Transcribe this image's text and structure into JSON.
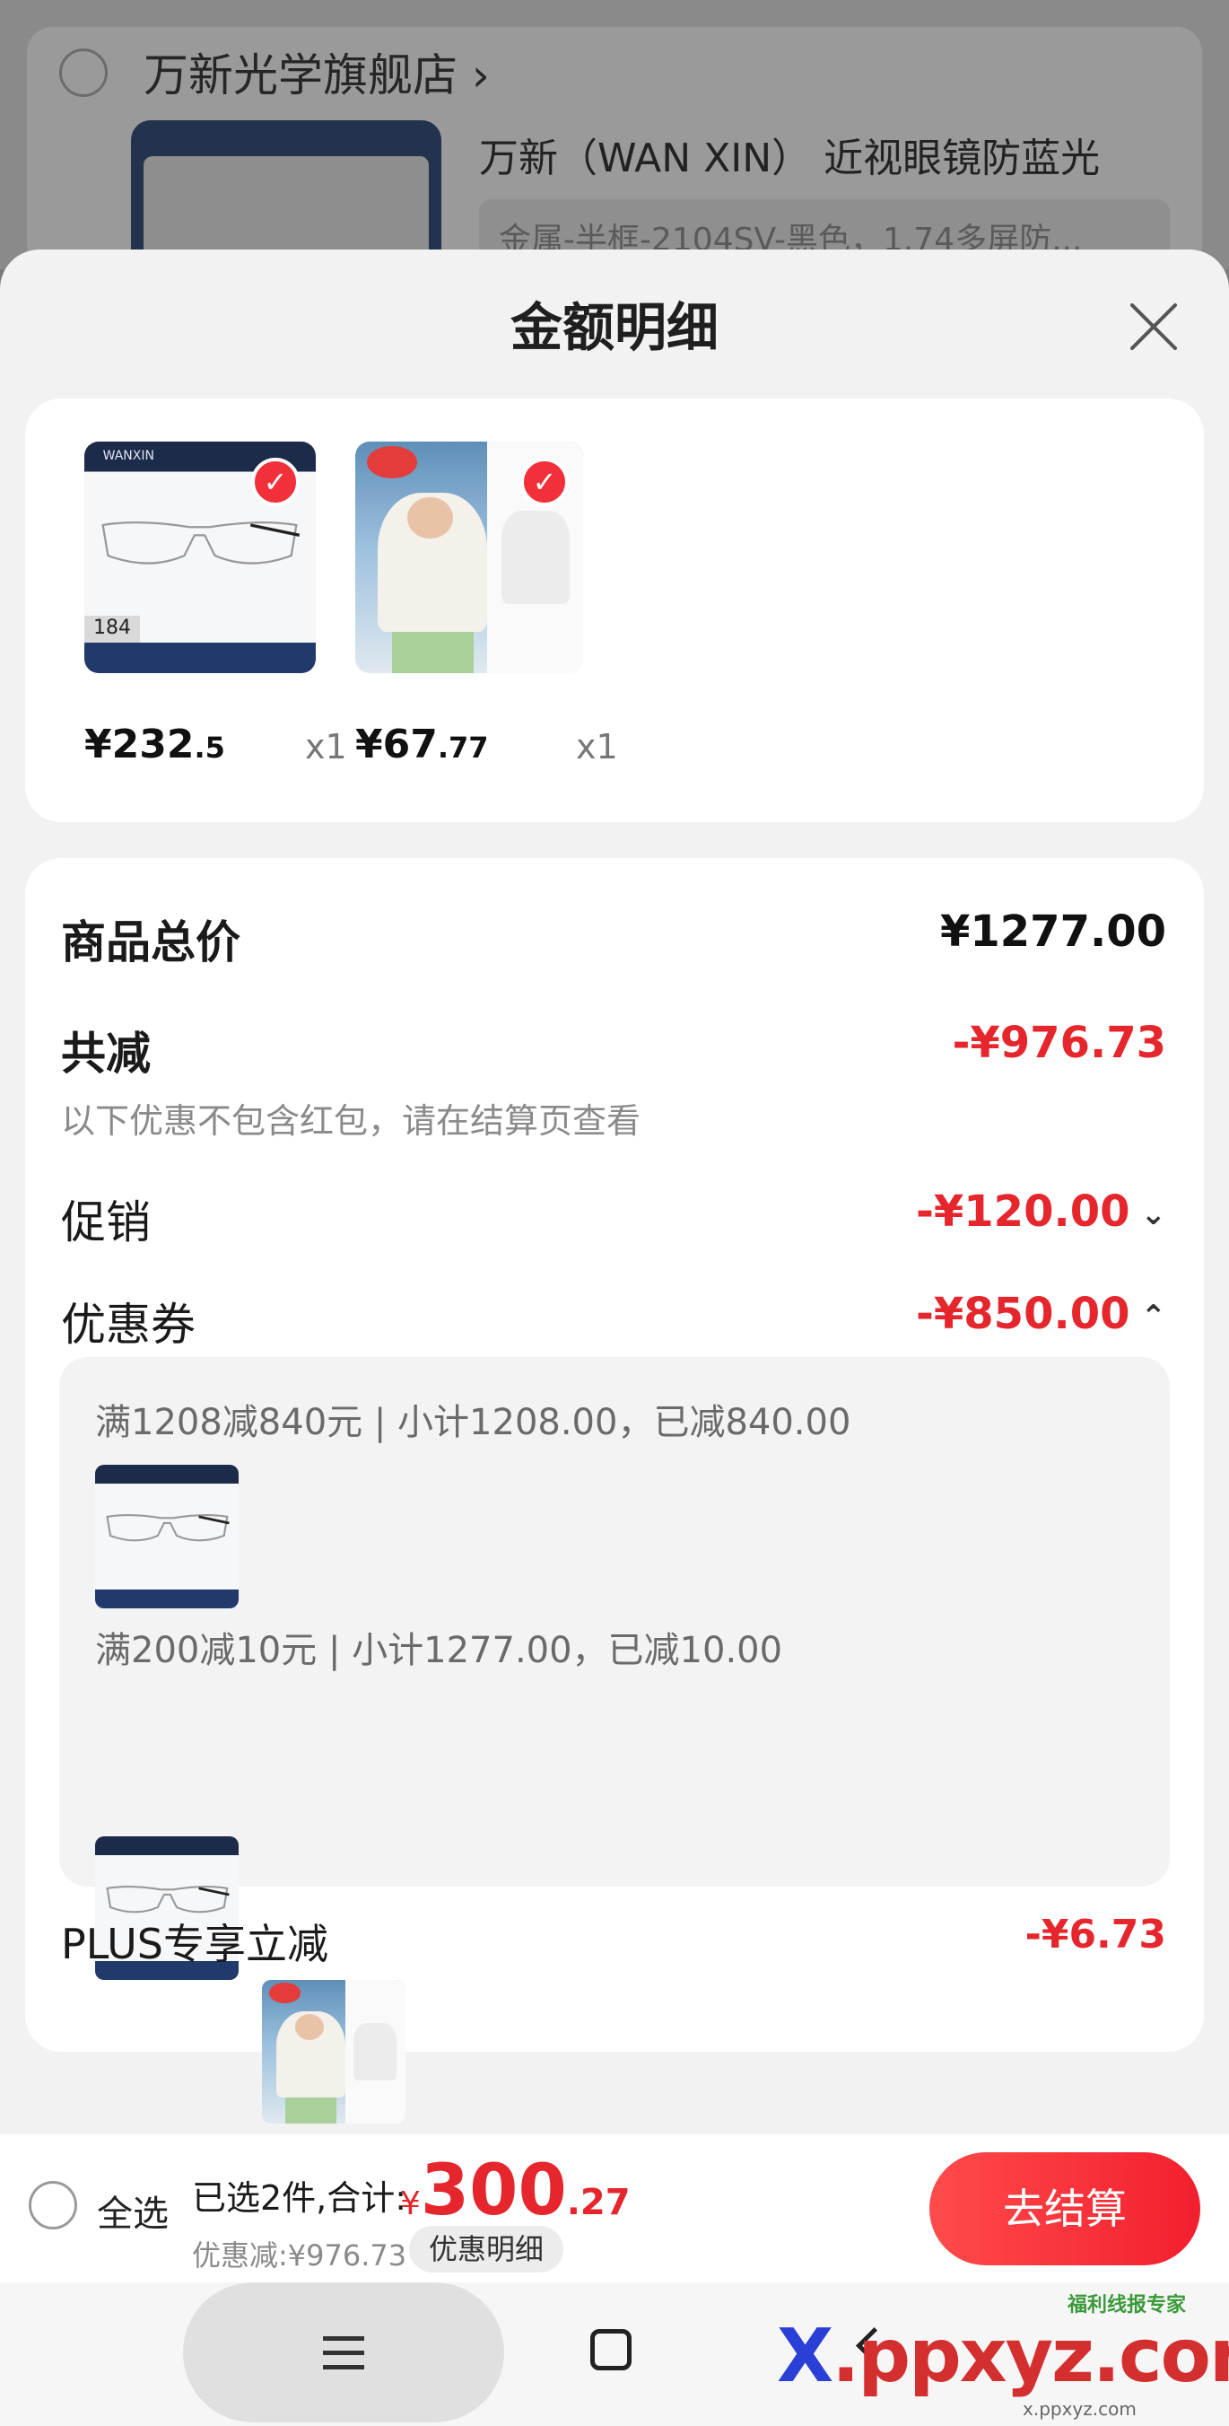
{
  "background": {
    "store_name": "万新光学旗舰店 ›",
    "product_title": "万新（WAN XIN） 近视眼镜防蓝光",
    "product_spec": "金属-半框-2104SV-黑色，1.74多屏防..."
  },
  "sheet": {
    "title": "金额明细"
  },
  "products": [
    {
      "price_int": "¥232",
      "price_dec": ".5",
      "qty": "x1",
      "thumb_price": "184"
    },
    {
      "price_int": "¥67",
      "price_dec": ".77",
      "qty": "x1"
    }
  ],
  "summary": {
    "total_label": "商品总价",
    "total_value": "¥1277.00",
    "discount_label": "共减",
    "discount_value": "-¥976.73",
    "discount_note": "以下优惠不包含红包，请在结算页查看",
    "promo_label": "促销",
    "promo_value": "-¥120.00",
    "coupon_label": "优惠券",
    "coupon_value": "-¥850.00",
    "coupons": [
      {
        "text": "满1208减840元 | 小计1208.00，已减840.00"
      },
      {
        "text": "满200减10元 | 小计1277.00，已减10.00"
      }
    ],
    "plus_label": "PLUS专享立减",
    "plus_value": "-¥6.73"
  },
  "bottom_bar": {
    "select_all": "全选",
    "selected_count": "已选2件,合计:",
    "total_yen": "¥",
    "total_big": "300",
    "total_cents": ".27",
    "saved": "优惠减:¥976.73",
    "detail_button": "优惠明细",
    "checkout_button": "去结算"
  },
  "watermark": {
    "text_a": "X",
    "text_b": ".ppxyz.com",
    "small": "福利线报专家",
    "url": "x.ppxyz.com"
  },
  "colors": {
    "accent_red": "#e5262d",
    "checkout_gradient": "#f21f2e"
  },
  "icons": [
    "close-icon",
    "check-icon",
    "chevron-down-icon",
    "chevron-up-icon",
    "menu-icon",
    "home-icon",
    "back-icon"
  ]
}
